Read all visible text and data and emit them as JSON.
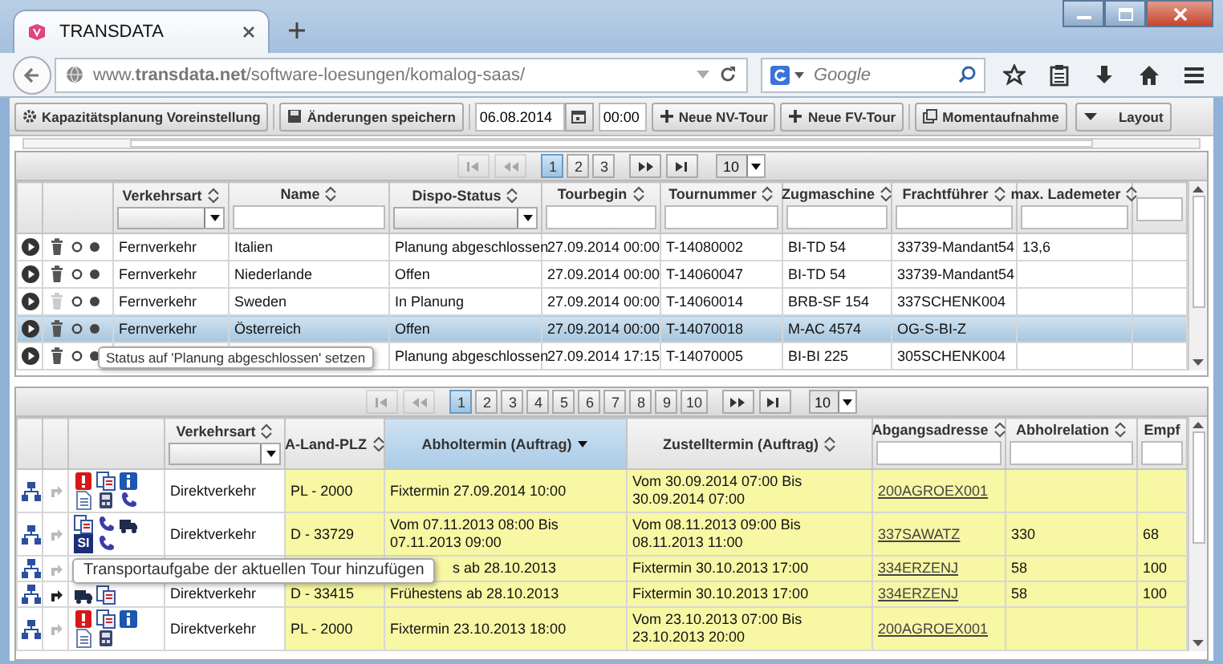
{
  "browser": {
    "tab": {
      "title": "TRANSDATA"
    },
    "url": "www.**transdata.net**/software-loesungen/komalog-saas/",
    "search": {
      "placeholder": "Google"
    }
  },
  "toolbar": {
    "buttons": [
      {
        "kind": "gear",
        "label": "Kapazitätsplanung Voreinstellung"
      },
      {
        "kind": "save",
        "label": "Änderungen speichern"
      }
    ],
    "date": "06.08.2014",
    "time": "00:00",
    "actions": [
      {
        "kind": "plus",
        "label": "Neue NV-Tour"
      },
      {
        "kind": "plus",
        "label": "Neue FV-Tour"
      },
      {
        "kind": "snapshot",
        "label": "Momentaufnahme"
      },
      {
        "kind": "dropdown",
        "label": "Layout"
      }
    ]
  },
  "tours": {
    "pager": {
      "nav_before": [
        {
          "kind": "first",
          "disabled": true
        },
        {
          "kind": "prev",
          "disabled": true
        }
      ],
      "pages": [
        {
          "label": "1",
          "selected": true
        },
        {
          "label": "2",
          "selected": false
        },
        {
          "label": "3",
          "selected": false
        }
      ],
      "nav_after": [
        {
          "kind": "next",
          "disabled": false
        },
        {
          "kind": "last",
          "disabled": false
        }
      ],
      "page_size": "10"
    },
    "columns": [
      {
        "label": "Verkehrsart",
        "filter": {
          "kind": "select"
        },
        "sortable": true,
        "sorted_descending": false
      },
      {
        "label": "Name",
        "filter": {
          "kind": "input"
        },
        "sortable": true,
        "sorted_descending": false
      },
      {
        "label": "Dispo-Status",
        "filter": {
          "kind": "select"
        },
        "sortable": true,
        "sorted_descending": false
      },
      {
        "label": "Tourbegin",
        "filter": {
          "kind": "input"
        },
        "sortable": true,
        "sorted_descending": false
      },
      {
        "label": "Tournummer",
        "filter": {
          "kind": "input"
        },
        "sortable": true,
        "sorted_descending": false
      },
      {
        "label": "Zugmaschine",
        "filter": {
          "kind": "input"
        },
        "sortable": true,
        "sorted_descending": false
      },
      {
        "label": "Frachtführer",
        "filter": {
          "kind": "input"
        },
        "sortable": true,
        "sorted_descending": false
      },
      {
        "label": "max. Lademeter",
        "filter": {
          "kind": "input"
        },
        "sortable": true,
        "sorted_descending": false
      },
      {
        "filter": {
          "kind": "input"
        },
        "sortable": false,
        "sorted_descending": false
      }
    ],
    "rows": [
      {
        "selected": false,
        "delete_disabled": false,
        "cells": [
          "Fernverkehr",
          "Italien",
          "Planung abgeschlossen",
          "27.09.2014 00:00",
          "T-14080002",
          "BI-TD 54",
          "33739-Mandant54",
          "13,6"
        ]
      },
      {
        "selected": false,
        "delete_disabled": false,
        "cells": [
          "Fernverkehr",
          "Niederlande",
          "Offen",
          "27.09.2014 00:00",
          "T-14060047",
          "BI-TD 54",
          "33739-Mandant54"
        ]
      },
      {
        "selected": false,
        "delete_disabled": true,
        "cells": [
          "Fernverkehr",
          "Sweden",
          "In Planung",
          "27.09.2014 00:00",
          "T-14060014",
          "BRB-SF 154",
          "337SCHENK004"
        ]
      },
      {
        "selected": true,
        "delete_disabled": false,
        "cells": [
          "Fernverkehr",
          "Österreich",
          "Offen",
          "27.09.2014 00:00",
          "T-14070018",
          "M-AC 4574",
          "OG-S-BI-Z"
        ]
      },
      {
        "selected": false,
        "delete_disabled": false,
        "tooltip": "Status auf 'Planung abgeschlossen' setzen",
        "cells": [
          null,
          null,
          "Planung abgeschlossen",
          "27.09.2014 17:15",
          "T-14070005",
          "BI-BI 225",
          "305SCHENK004"
        ]
      }
    ]
  },
  "orders": {
    "pager": {
      "nav_before": [
        {
          "kind": "first",
          "disabled": true
        },
        {
          "kind": "prev",
          "disabled": true
        }
      ],
      "pages": [
        {
          "label": "1",
          "selected": true
        },
        {
          "label": "2",
          "selected": false
        },
        {
          "label": "3",
          "selected": false
        },
        {
          "label": "4",
          "selected": false
        },
        {
          "label": "5",
          "selected": false
        },
        {
          "label": "6",
          "selected": false
        },
        {
          "label": "7",
          "selected": false
        },
        {
          "label": "8",
          "selected": false
        },
        {
          "label": "9",
          "selected": false
        },
        {
          "label": "10",
          "selected": false
        }
      ],
      "nav_after": [
        {
          "kind": "next",
          "disabled": false
        },
        {
          "kind": "last",
          "disabled": false
        }
      ],
      "page_size": "10"
    },
    "columns": [
      {
        "label": "Verkehrsart",
        "filter": {
          "kind": "select"
        },
        "sortable": true,
        "sorted_descending": false
      },
      {
        "label": "A-Land-PLZ",
        "sortable": true,
        "sorted_descending": false
      },
      {
        "label": "Abholtermin (Auftrag)",
        "sortable": true,
        "sorted_descending": true
      },
      {
        "label": "Zustelltermin (Auftrag)",
        "sortable": true,
        "sorted_descending": false
      },
      {
        "label": "Abgangsadresse",
        "filter": {
          "kind": "input"
        },
        "sortable": true,
        "sorted_descending": false
      },
      {
        "label": "Abholrelation",
        "filter": {
          "kind": "input"
        },
        "sortable": true,
        "sorted_descending": false
      },
      {
        "label": "Empf",
        "filter": {
          "kind": "input"
        },
        "sortable": false,
        "sorted_descending": false
      }
    ],
    "rows": [
      {
        "highlighted": true,
        "arrow_enabled": false,
        "icons": [
          {
            "kind": "alert"
          },
          {
            "kind": "swap"
          },
          {
            "kind": "info"
          },
          {
            "kind": "document"
          },
          {
            "kind": "device"
          },
          {
            "kind": "phone"
          }
        ],
        "verkehrsart": "Direktverkehr",
        "a_land": "PL - 2000",
        "abholtermin": "Fixtermin 27.09.2014 10:00",
        "zustelltermin": "Vom 30.09.2014 07:00 Bis 30.09.2014 07:00",
        "abgangsadresse": "200AGROEX001"
      },
      {
        "highlighted": true,
        "arrow_enabled": false,
        "icons": [
          {
            "kind": "swap"
          },
          {
            "kind": "phone"
          },
          {
            "kind": "truck"
          },
          {
            "kind": "badge",
            "label": "SI"
          },
          {
            "kind": "phone"
          }
        ],
        "verkehrsart": "Direktverkehr",
        "a_land": "D - 33729",
        "abholtermin": "Vom 07.11.2013 08:00 Bis 07.11.2013 09:00",
        "zustelltermin": "Vom 08.11.2013 09:00 Bis 08.11.2013 11:00",
        "abgangsadresse": "337SAWATZ",
        "abholrelation": "330",
        "empf": "68"
      },
      {
        "highlighted": true,
        "arrow_enabled": false,
        "tooltip": "Transportaufgabe der aktuellen Tour hinzufügen",
        "abholtermin": "s ab 28.10.2013",
        "zustelltermin": "Fixtermin 30.10.2013 17:00",
        "abgangsadresse": "334ERZENJ",
        "abholrelation": "58",
        "empf": "100"
      },
      {
        "highlighted": true,
        "arrow_enabled": true,
        "icons": [
          {
            "kind": "truck"
          },
          {
            "kind": "swap"
          }
        ],
        "verkehrsart": "Direktverkehr",
        "a_land": "D - 33415",
        "abholtermin": "Frühestens ab 28.10.2013",
        "zustelltermin": "Fixtermin 30.10.2013 17:00",
        "abgangsadresse": "334ERZENJ",
        "abholrelation": "58",
        "empf": "100"
      },
      {
        "highlighted": true,
        "arrow_enabled": false,
        "icons": [
          {
            "kind": "alert"
          },
          {
            "kind": "swap"
          },
          {
            "kind": "info"
          },
          {
            "kind": "document"
          },
          {
            "kind": "device"
          }
        ],
        "verkehrsart": "Direktverkehr",
        "a_land": "PL - 2000",
        "abholtermin": "Fixtermin 23.10.2013 18:00",
        "zustelltermin": "Vom 23.10.2013 07:00 Bis 23.10.2013 20:00",
        "abgangsadresse": "200AGROEX001"
      }
    ]
  }
}
